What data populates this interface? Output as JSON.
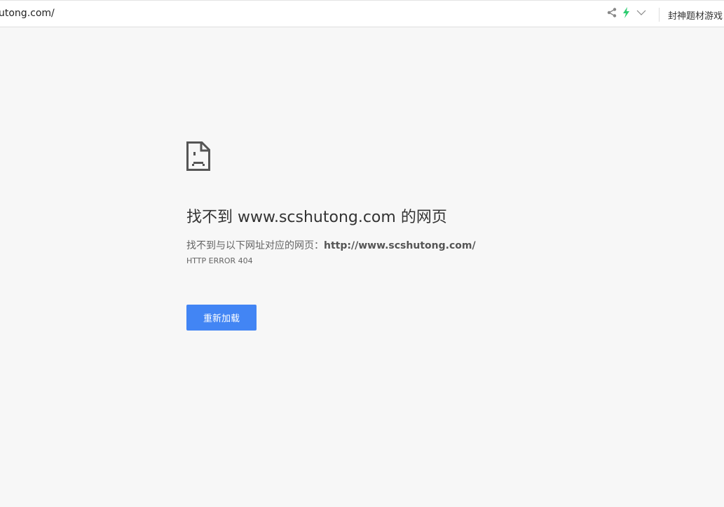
{
  "address_bar": {
    "url": "utong.com/",
    "side_text": "封神题材游戏"
  },
  "icons": {
    "share": "share-icon",
    "bolt": "lightning-icon",
    "chevron": "chevron-down-icon",
    "error": "sad-page-icon"
  },
  "colors": {
    "bolt": "#2ecc71",
    "button": "#4285f4"
  },
  "error": {
    "title": "找不到 www.scshutong.com 的网页",
    "desc_prefix": "找不到与以下网址对应的网页：",
    "desc_url": "http://www.scshutong.com/",
    "code": "HTTP ERROR 404",
    "reload_label": "重新加载"
  }
}
